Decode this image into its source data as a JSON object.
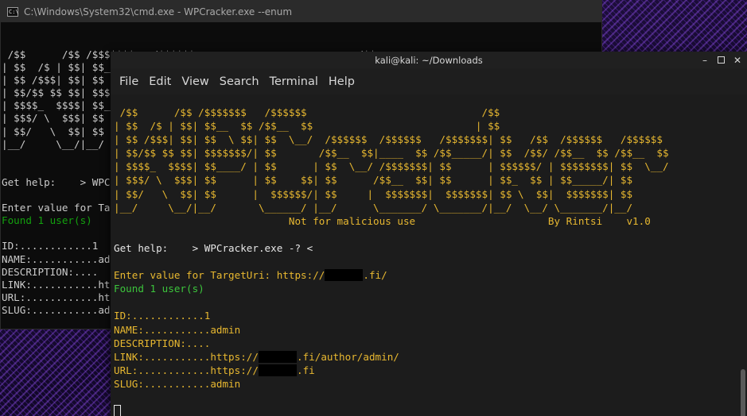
{
  "cmd": {
    "title": "C:\\Windows\\System32\\cmd.exe - WPCracker.exe  --enum",
    "lines": [
      " /$$      /$$ /$$$$$$$   /$$$$$$                           /$$",
      "| $$  /$ | $$| $$__  $$ /$$__  $$                         | $$",
      "| $$ /$$$| $$| $$  \\ $$| $$  \\__/  /$$$$$$   /$$$$$$    | $$",
      "| $$/$$ $$ $$| $$$$$$$/| $$       /$$__  $$ |____  $$   | $$",
      "| $$$$_  $$$$| $$____/ | $$      | $$  \\__/  /$$$$$$$   | $$",
      "| $$$/ \\  $$$| $$      | $$    $$| $$       /$$__  $$   | $$",
      "| $$/   \\  $$| $$      |  $$$$$$/| $$      |  $$$$$$$   | $$",
      "|__/     \\__/|__/       \\______/ |__/       \\_______/   |__/",
      "",
      "",
      "Get help:    > WPCracker.exe -? <",
      "",
      "Enter value for TargetUri: https://",
      "Found 1 user(s)",
      "",
      "ID:............1",
      "NAME:...........admin",
      "DESCRIPTION:....",
      "LINK:...........https://",
      "URL:............https://",
      "SLUG:...........admin"
    ]
  },
  "terminal": {
    "title": "kali@kali: ~/Downloads",
    "menu": [
      "File",
      "Edit",
      "View",
      "Search",
      "Terminal",
      "Help"
    ],
    "controls": {
      "minimize": "–",
      "close": "✕"
    },
    "banner": [
      " /$$      /$$ /$$$$$$$   /$$$$$$                             /$$",
      "| $$  /$ | $$| $$__  $$ /$$__  $$                           | $$",
      "| $$ /$$$| $$| $$  \\ $$| $$  \\__/  /$$$$$$  /$$$$$$   /$$$$$$$| $$   /$$  /$$$$$$   /$$$$$$",
      "| $$/$$ $$ $$| $$$$$$$/| $$       /$$__  $$|____  $$ /$$_____/| $$  /$$/ /$$__  $$ /$$__  $$",
      "| $$$$_  $$$$| $$____/ | $$      | $$  \\__/ /$$$$$$$| $$      | $$$$$$/ | $$$$$$$$| $$  \\__/",
      "| $$$/ \\  $$$| $$      | $$    $$| $$      /$$__  $$| $$      | $$_  $$ | $$_____/| $$",
      "| $$/   \\  $$| $$      |  $$$$$$/| $$     |  $$$$$$$|  $$$$$$$| $$ \\  $$|  $$$$$$$| $$",
      "|__/     \\__/|__/       \\______/ |__/      \\_______/ \\_______/|__/  \\__/ \\_______/|__/"
    ],
    "tagline": "                             Not for malicious use                      By Rintsi    v1.0",
    "help_line": "Get help:    > WPCracker.exe -? <",
    "enter_prefix": "Enter value for TargetUri: https://",
    "enter_suffix": ".fi/",
    "found": "Found 1 user(s)",
    "id_line": "ID:............1",
    "name_line": "NAME:...........admin",
    "desc_line": "DESCRIPTION:....",
    "link_prefix": "LINK:...........https://",
    "link_suffix": ".fi/author/admin/",
    "url_prefix": "URL:............https://",
    "url_suffix": ".fi",
    "slug_line": "SLUG:...........admin"
  },
  "colors": {
    "banner": "#e8b830",
    "green": "#3cc53c",
    "text": "#d9c89a"
  }
}
